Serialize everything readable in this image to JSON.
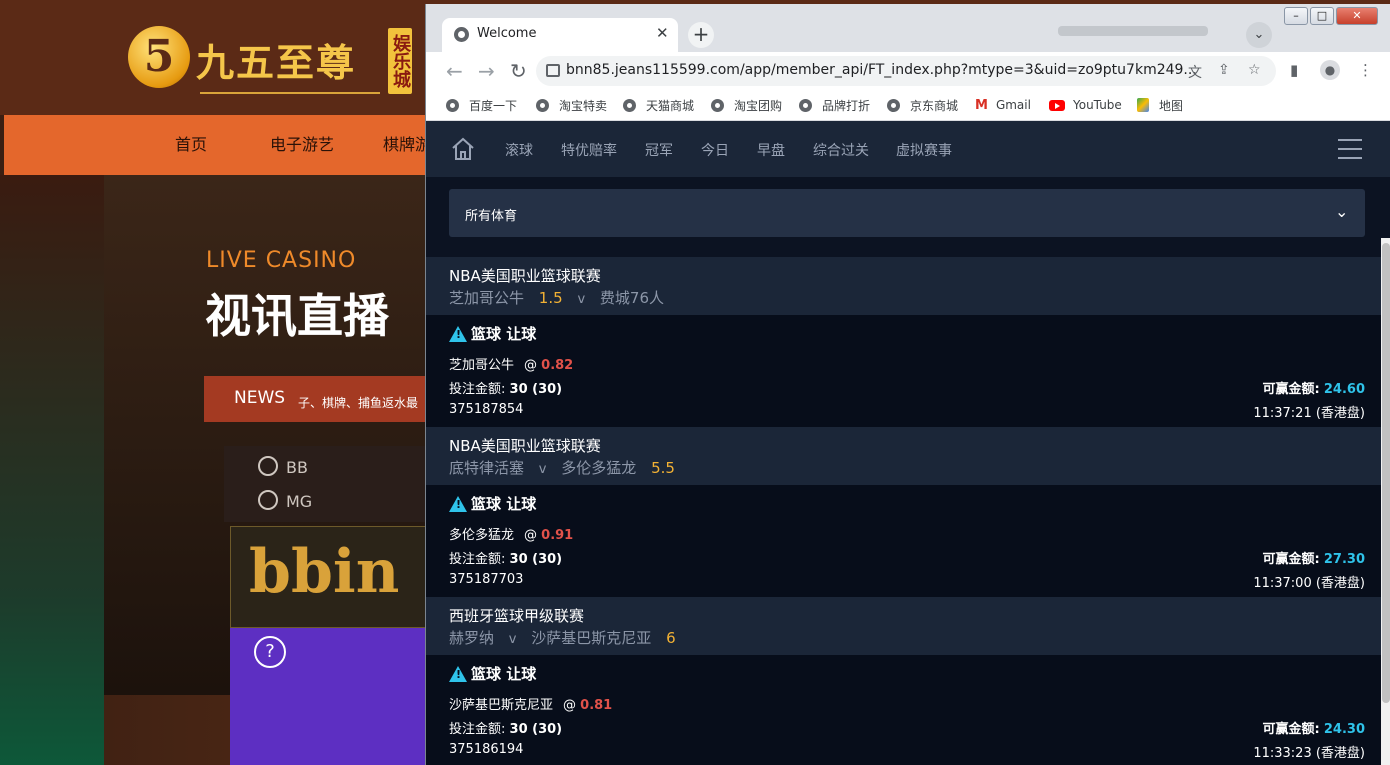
{
  "background_page": {
    "logo_glyph": "5",
    "logo_text": "九五至尊",
    "logo_tag": "娱乐城",
    "nav": [
      "首页",
      "电子游艺",
      "棋牌游"
    ],
    "live_casino": "LIVE CASINO",
    "hero_title": "视讯直播",
    "news_label": "NEWS",
    "news_text": "子、棋牌、捕鱼返水最",
    "providers": [
      "BB",
      "MG"
    ],
    "bbin_logo": "bbin",
    "help_glyph": "?"
  },
  "browser": {
    "tab_title": "Welcome",
    "tab_close": "✕",
    "new_tab": "+",
    "tab_search": "⌄",
    "window_buttons": [
      "–",
      "□",
      "✕"
    ],
    "url": "bnn85.jeans115599.com/app/member_api/FT_index.php?mtype=3&uid=zo9ptu7km249...",
    "bookmarks": [
      {
        "label": "百度一下",
        "icon": "globe-icon"
      },
      {
        "label": "淘宝特卖",
        "icon": "globe-icon"
      },
      {
        "label": "天猫商城",
        "icon": "globe-icon"
      },
      {
        "label": "淘宝团购",
        "icon": "globe-icon"
      },
      {
        "label": "品牌打折",
        "icon": "globe-icon"
      },
      {
        "label": "京东商城",
        "icon": "globe-icon"
      },
      {
        "label": "Gmail",
        "icon": "gmail-icon"
      },
      {
        "label": "YouTube",
        "icon": "youtube-icon"
      },
      {
        "label": "地图",
        "icon": "maps-icon"
      }
    ]
  },
  "app": {
    "nav": [
      "滚球",
      "特优赔率",
      "冠军",
      "今日",
      "早盘",
      "综合过关",
      "虚拟赛事"
    ],
    "sport_filter": "所有体育",
    "stake_label": "投注金额:",
    "win_label": "可赢金额:",
    "bets": [
      {
        "league": "NBA美国职业篮球联赛",
        "home": "芝加哥公牛",
        "home_hcp": "1.5",
        "vs": "v",
        "away": "费城76人",
        "away_hcp": "",
        "bet_type": "篮球 让球",
        "pick": "芝加哥公牛",
        "at": "@",
        "odds": "0.82",
        "stake": "30 (30)",
        "win": "24.60",
        "ticket": "375187854",
        "time": "11:37:21 (香港盘)"
      },
      {
        "league": "NBA美国职业篮球联赛",
        "home": "底特律活塞",
        "home_hcp": "",
        "vs": "v",
        "away": "多伦多猛龙",
        "away_hcp": "5.5",
        "bet_type": "篮球 让球",
        "pick": "多伦多猛龙",
        "at": "@",
        "odds": "0.91",
        "stake": "30 (30)",
        "win": "27.30",
        "ticket": "375187703",
        "time": "11:37:00 (香港盘)"
      },
      {
        "league": "西班牙篮球甲级联赛",
        "home": "赫罗纳",
        "home_hcp": "",
        "vs": "v",
        "away": "沙萨基巴斯克尼亚",
        "away_hcp": "6",
        "bet_type": "篮球 让球",
        "pick": "沙萨基巴斯克尼亚",
        "at": "@",
        "odds": "0.81",
        "stake": "30 (30)",
        "win": "24.30",
        "ticket": "375186194",
        "time": "11:33:23 (香港盘)"
      }
    ]
  },
  "colors": {
    "odds": "#e2524a",
    "win_amount": "#2fc3ea",
    "handicap": "#f2b134",
    "nav_bg": "#1b2638",
    "content_bg": "#070d1a"
  }
}
